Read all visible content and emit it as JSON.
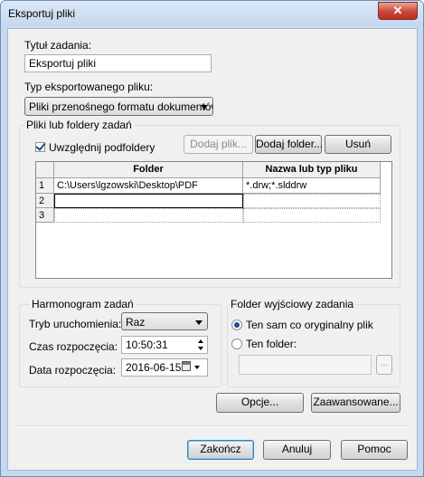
{
  "window": {
    "title": "Eksportuj pliki",
    "close_glyph": "✕"
  },
  "task": {
    "title_label": "Tytuł zadania:",
    "title_value": "Eksportuj pliki",
    "type_label": "Typ eksportowanego pliku:",
    "type_value": "Pliki przenośnego formatu dokumentów"
  },
  "files_group": {
    "title": "Pliki lub foldery zadań",
    "include_subfolders_label": "Uwzględnij podfoldery",
    "include_subfolders_checked": true,
    "add_file_button": "Dodaj plik...",
    "add_folder_button": "Dodaj folder...",
    "remove_button": "Usuń",
    "columns": [
      "Folder",
      "Nazwa lub typ pliku"
    ],
    "rows": [
      {
        "num": "1",
        "folder": "C:\\Users\\lgzowski\\Desktop\\PDF",
        "name": "*.drw;*.slddrw"
      },
      {
        "num": "2",
        "folder": "",
        "name": ""
      },
      {
        "num": "3",
        "folder": "",
        "name": ""
      }
    ]
  },
  "schedule": {
    "title": "Harmonogram zadań",
    "mode_label": "Tryb uruchomienia:",
    "mode_value": "Raz",
    "start_time_label": "Czas rozpoczęcia:",
    "start_time_value": "10:50:31",
    "start_date_label": "Data rozpoczęcia:",
    "start_date_value": "2016-06-15"
  },
  "output": {
    "title": "Folder wyjściowy zadania",
    "same_as_original_label": "Ten sam co oryginalny plik",
    "this_folder_label": "Ten folder:",
    "folder_value": "",
    "browse_button": "..."
  },
  "buttons": {
    "options": "Opcje...",
    "advanced": "Zaawansowane...",
    "finish": "Zakończ",
    "cancel": "Anuluj",
    "help": "Pomoc"
  },
  "colors": {
    "titlebar": "#c5d8ee",
    "close": "#c9483a",
    "selected_radio": "#1a4b8e"
  }
}
